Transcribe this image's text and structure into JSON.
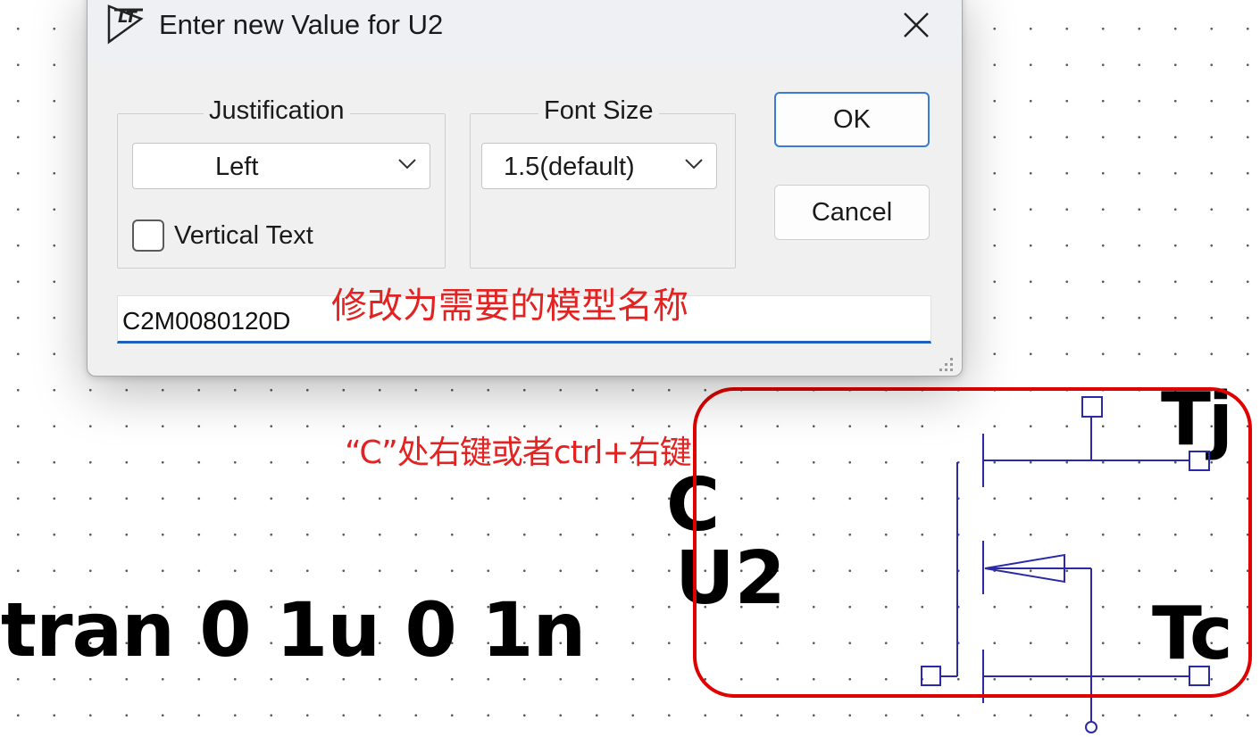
{
  "dialog": {
    "title": "Enter new Value for U2",
    "justification": {
      "group_label": "Justification",
      "selected": "Left",
      "vertical_text_label": "Vertical Text",
      "vertical_text_checked": false
    },
    "font_size": {
      "group_label": "Font Size",
      "selected": "1.5(default)"
    },
    "ok_label": "OK",
    "cancel_label": "Cancel",
    "value_input": "C2M0080120D"
  },
  "annotations": {
    "model_hint": "修改为需要的模型名称",
    "click_hint": "“C”处右键或者ctrl+右键"
  },
  "schematic": {
    "directive": ".tran 0 1u 0 1n",
    "component_value": "C",
    "component_name": "U2",
    "pin_tj": "Tj",
    "pin_tc": "Tc"
  },
  "colors": {
    "wire": "#2a2aa8",
    "highlight": "#e00000",
    "annotation": "#e32222",
    "focus": "#1f5fbf"
  },
  "icons": [
    "lt-logo-icon",
    "close-icon",
    "chevron-down-icon",
    "resize-grip-icon"
  ]
}
